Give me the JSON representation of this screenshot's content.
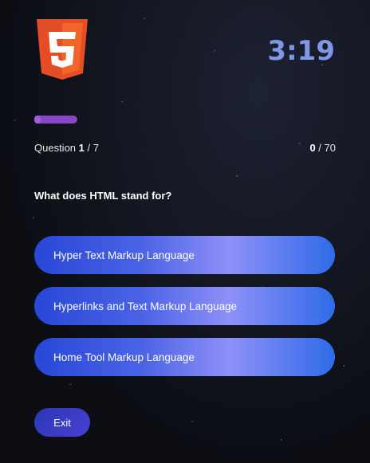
{
  "logo": {
    "icon": "html5-logo-icon",
    "color_primary": "#e44d26",
    "color_secondary": "#f16529"
  },
  "timer": {
    "value": "3:19",
    "color": "#7f97e6"
  },
  "progress": {
    "fraction": 0.14,
    "color": "#8a45c9"
  },
  "question_counter": {
    "label": "Question",
    "current": "1",
    "separator": " / ",
    "total": "7"
  },
  "score": {
    "current": "0",
    "separator": " / ",
    "total": "70"
  },
  "question": {
    "text": "What does HTML stand for?"
  },
  "answers": [
    {
      "label": "Hyper Text Markup Language"
    },
    {
      "label": "Hyperlinks and Text Markup Language"
    },
    {
      "label": "Home Tool Markup Language"
    }
  ],
  "exit": {
    "label": "Exit"
  }
}
